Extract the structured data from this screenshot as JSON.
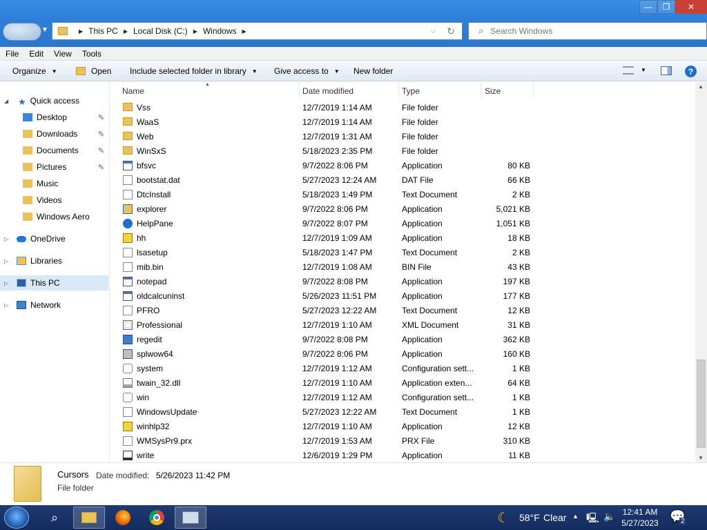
{
  "window": {
    "controls": {
      "minimize": "—",
      "maximize": "❐",
      "close": "✕"
    }
  },
  "address": {
    "crumbs": [
      "This PC",
      "Local Disk (C:)",
      "Windows"
    ],
    "sep": "▶",
    "dropdown": "⌵",
    "refresh": "↻"
  },
  "search": {
    "placeholder": "Search Windows",
    "icon": "⌕"
  },
  "menu": [
    "File",
    "Edit",
    "View",
    "Tools"
  ],
  "toolbar": {
    "organize": "Organize",
    "open": "Open",
    "include": "Include selected folder in library",
    "share": "Give access to",
    "new_folder": "New folder",
    "dd": "▼",
    "help": "?"
  },
  "nav": {
    "quick_access": "Quick access",
    "items": [
      "Desktop",
      "Downloads",
      "Documents",
      "Pictures",
      "Music",
      "Videos",
      "Windows Aero"
    ],
    "onedrive": "OneDrive",
    "libraries": "Libraries",
    "this_pc": "This PC",
    "network": "Network",
    "pin": "📌",
    "expanded": "◢",
    "collapsed": "▷"
  },
  "columns": {
    "name": "Name",
    "date": "Date modified",
    "type": "Type",
    "size": "Size",
    "sort": "▲"
  },
  "files": [
    {
      "name": "Vss",
      "date": "12/7/2019 1:14 AM",
      "type": "File folder",
      "size": "",
      "icon": "folder-icon"
    },
    {
      "name": "WaaS",
      "date": "12/7/2019 1:14 AM",
      "type": "File folder",
      "size": "",
      "icon": "folder-icon"
    },
    {
      "name": "Web",
      "date": "12/7/2019 1:31 AM",
      "type": "File folder",
      "size": "",
      "icon": "folder-icon"
    },
    {
      "name": "WinSxS",
      "date": "5/18/2023 2:35 PM",
      "type": "File folder",
      "size": "",
      "icon": "folder-icon"
    },
    {
      "name": "bfsvc",
      "date": "9/7/2022 8:06 PM",
      "type": "Application",
      "size": "80 KB",
      "icon": "app-icon"
    },
    {
      "name": "bootstat.dat",
      "date": "5/27/2023 12:24 AM",
      "type": "DAT File",
      "size": "66 KB",
      "icon": "file-icon"
    },
    {
      "name": "DtcInstall",
      "date": "5/18/2023 1:49 PM",
      "type": "Text Document",
      "size": "2 KB",
      "icon": "file-icon"
    },
    {
      "name": "explorer",
      "date": "9/7/2022 8:06 PM",
      "type": "Application",
      "size": "5,021 KB",
      "icon": "explorer-icon"
    },
    {
      "name": "HelpPane",
      "date": "9/7/2022 8:07 PM",
      "type": "Application",
      "size": "1,051 KB",
      "icon": "help-icon"
    },
    {
      "name": "hh",
      "date": "12/7/2019 1:09 AM",
      "type": "Application",
      "size": "18 KB",
      "icon": "help-doc-icon"
    },
    {
      "name": "lsasetup",
      "date": "5/18/2023 1:47 PM",
      "type": "Text Document",
      "size": "2 KB",
      "icon": "file-icon"
    },
    {
      "name": "mib.bin",
      "date": "12/7/2019 1:08 AM",
      "type": "BIN File",
      "size": "43 KB",
      "icon": "file-icon"
    },
    {
      "name": "notepad",
      "date": "9/7/2022 8:08 PM",
      "type": "Application",
      "size": "197 KB",
      "icon": "app-icon"
    },
    {
      "name": "oldcalcuninst",
      "date": "5/26/2023 11:51 PM",
      "type": "Application",
      "size": "177 KB",
      "icon": "app-icon"
    },
    {
      "name": "PFRO",
      "date": "5/27/2023 12:22 AM",
      "type": "Text Document",
      "size": "12 KB",
      "icon": "file-icon"
    },
    {
      "name": "Professional",
      "date": "12/7/2019 1:10 AM",
      "type": "XML Document",
      "size": "31 KB",
      "icon": "xml-icon"
    },
    {
      "name": "regedit",
      "date": "9/7/2022 8:08 PM",
      "type": "Application",
      "size": "362 KB",
      "icon": "regedit-icon"
    },
    {
      "name": "splwow64",
      "date": "9/7/2022 8:06 PM",
      "type": "Application",
      "size": "160 KB",
      "icon": "printer-icon"
    },
    {
      "name": "system",
      "date": "12/7/2019 1:12 AM",
      "type": "Configuration sett...",
      "size": "1 KB",
      "icon": "config-icon"
    },
    {
      "name": "twain_32.dll",
      "date": "12/7/2019 1:10 AM",
      "type": "Application exten...",
      "size": "64 KB",
      "icon": "dll-icon"
    },
    {
      "name": "win",
      "date": "12/7/2019 1:12 AM",
      "type": "Configuration sett...",
      "size": "1 KB",
      "icon": "config-icon"
    },
    {
      "name": "WindowsUpdate",
      "date": "5/27/2023 12:22 AM",
      "type": "Text Document",
      "size": "1 KB",
      "icon": "file-icon"
    },
    {
      "name": "winhlp32",
      "date": "12/7/2019 1:10 AM",
      "type": "Application",
      "size": "12 KB",
      "icon": "help-doc-icon"
    },
    {
      "name": "WMSysPr9.prx",
      "date": "12/7/2019 1:53 AM",
      "type": "PRX File",
      "size": "310 KB",
      "icon": "file-icon"
    },
    {
      "name": "write",
      "date": "12/6/2019 1:29 PM",
      "type": "Application",
      "size": "11 KB",
      "icon": "write-icon"
    }
  ],
  "details": {
    "name": "Cursors",
    "date_label": "Date modified:",
    "date_value": "5/26/2023 11:42 PM",
    "type": "File folder"
  },
  "taskbar": {
    "weather_temp": "58°F",
    "weather_cond": "Clear",
    "time": "12:41 AM",
    "date": "5/27/2023",
    "notif_count": "2",
    "tray_chevron": "▲",
    "moon": "☾",
    "monitor": "🖳",
    "speaker": "🔈",
    "search_glyph": "⌕"
  },
  "colors": {
    "accent": "#2a76cf",
    "taskbar": "#1e3a73",
    "selection": "#d9e8f7"
  }
}
